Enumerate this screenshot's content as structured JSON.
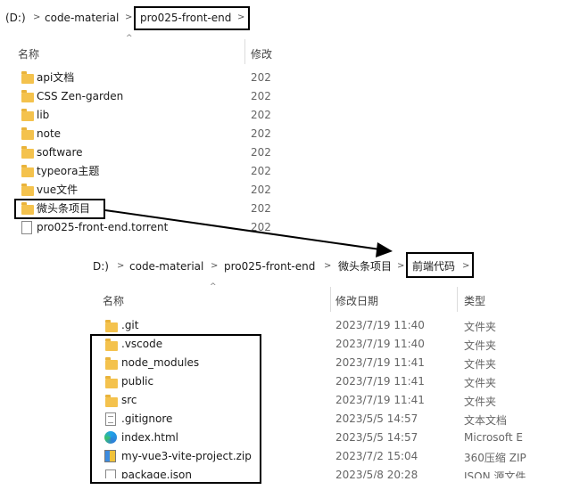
{
  "top_window": {
    "breadcrumb": [
      "(D:)",
      "code-material",
      "pro025-front-end"
    ],
    "columns": {
      "name": "名称",
      "modified": "修改"
    },
    "rows": [
      {
        "name": "api文档",
        "date": "202",
        "kind": "folder"
      },
      {
        "name": "CSS Zen-garden",
        "date": "202",
        "kind": "folder"
      },
      {
        "name": "lib",
        "date": "202",
        "kind": "folder"
      },
      {
        "name": "note",
        "date": "202",
        "kind": "folder"
      },
      {
        "name": "software",
        "date": "202",
        "kind": "folder"
      },
      {
        "name": "typeora主题",
        "date": "202",
        "kind": "folder"
      },
      {
        "name": "vue文件",
        "date": "202",
        "kind": "folder"
      },
      {
        "name": "微头条项目",
        "date": "202",
        "kind": "folder"
      },
      {
        "name": "pro025-front-end.torrent",
        "date": "202",
        "kind": "file"
      }
    ]
  },
  "bottom_window": {
    "breadcrumb": [
      "D:)",
      "code-material",
      "pro025-front-end",
      "微头条项目",
      "前端代码"
    ],
    "columns": {
      "name": "名称",
      "modified": "修改日期",
      "type": "类型"
    },
    "rows": [
      {
        "name": ".git",
        "date": "2023/7/19 11:40",
        "type": "文件夹",
        "kind": "folder"
      },
      {
        "name": ".vscode",
        "date": "2023/7/19 11:40",
        "type": "文件夹",
        "kind": "folder"
      },
      {
        "name": "node_modules",
        "date": "2023/7/19 11:41",
        "type": "文件夹",
        "kind": "folder"
      },
      {
        "name": "public",
        "date": "2023/7/19 11:41",
        "type": "文件夹",
        "kind": "folder"
      },
      {
        "name": "src",
        "date": "2023/7/19 11:41",
        "type": "文件夹",
        "kind": "folder"
      },
      {
        "name": ".gitignore",
        "date": "2023/5/5 14:57",
        "type": "文本文档",
        "kind": "text"
      },
      {
        "name": "index.html",
        "date": "2023/5/5 14:57",
        "type": "Microsoft E",
        "kind": "edge"
      },
      {
        "name": "my-vue3-vite-project.zip",
        "date": "2023/7/2 15:04",
        "type": "360压缩 ZIP",
        "kind": "zip"
      },
      {
        "name": "package.json",
        "date": "2023/5/8 20:28",
        "type": "JSON 源文件",
        "kind": "file"
      }
    ]
  },
  "colors": {
    "folder": "#f4c24d",
    "annotation": "#000000"
  }
}
